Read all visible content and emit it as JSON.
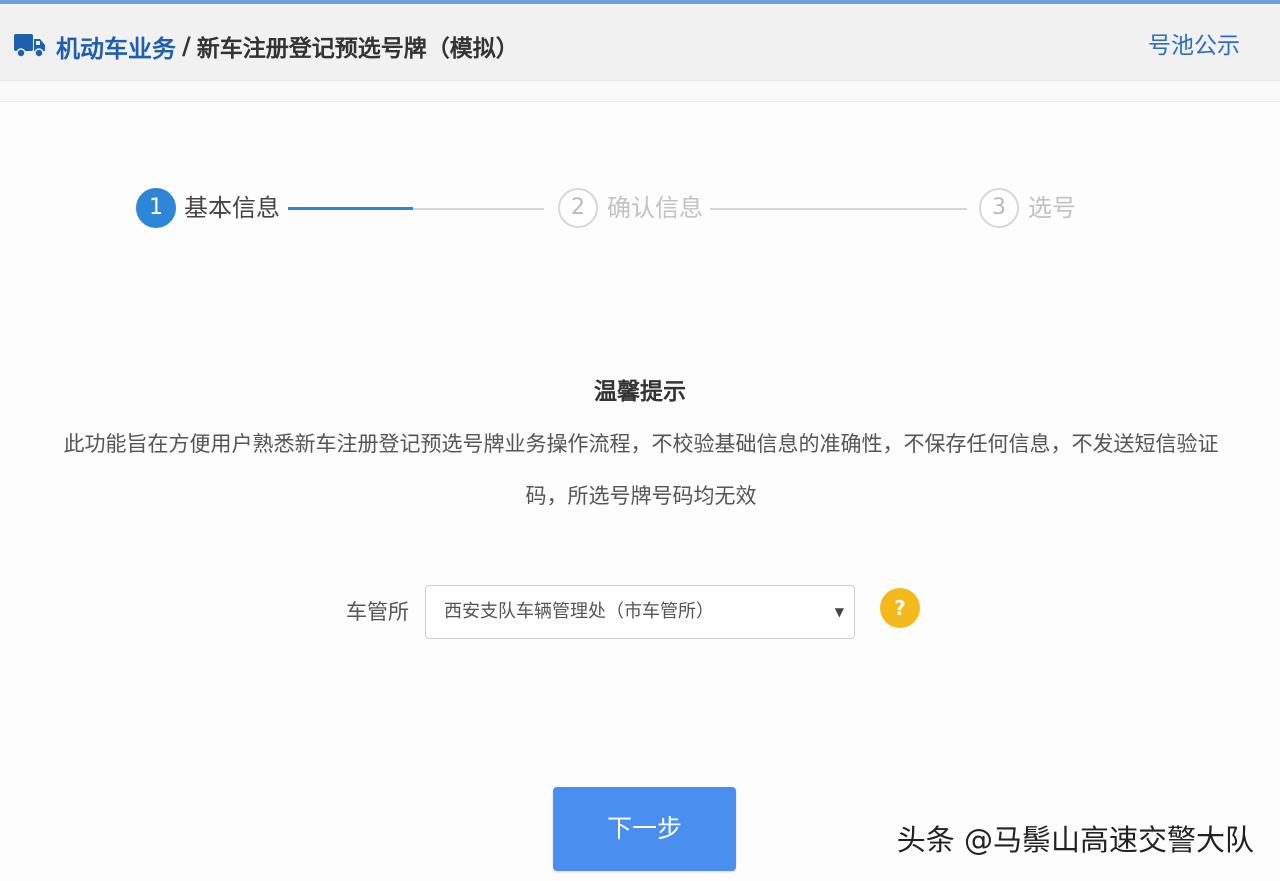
{
  "header": {
    "root_label": "机动车业务",
    "separator": "/",
    "page_title": "新车注册登记预选号牌（模拟）",
    "pool_link": "号池公示",
    "icon": "truck-icon"
  },
  "steps": [
    {
      "number": "1",
      "label": "基本信息",
      "state": "active"
    },
    {
      "number": "2",
      "label": "确认信息",
      "state": "inactive"
    },
    {
      "number": "3",
      "label": "选号",
      "state": "inactive"
    }
  ],
  "notice": {
    "title": "温馨提示",
    "body": "此功能旨在方便用户熟悉新车注册登记预选号牌业务操作流程，不校验基础信息的准确性，不保存任何信息，不发送短信验证码，所选号牌号码均无效"
  },
  "form": {
    "office_label": "车管所",
    "office_value": "西安支队车辆管理处（市车管所）",
    "help_symbol": "?"
  },
  "actions": {
    "next_label": "下一步"
  },
  "watermark": "头条 @马鬃山高速交警大队",
  "colors": {
    "accent": "#2e86d9",
    "header_link": "#1e5fb0",
    "button": "#4a8ff0",
    "help": "#f5b91b"
  }
}
